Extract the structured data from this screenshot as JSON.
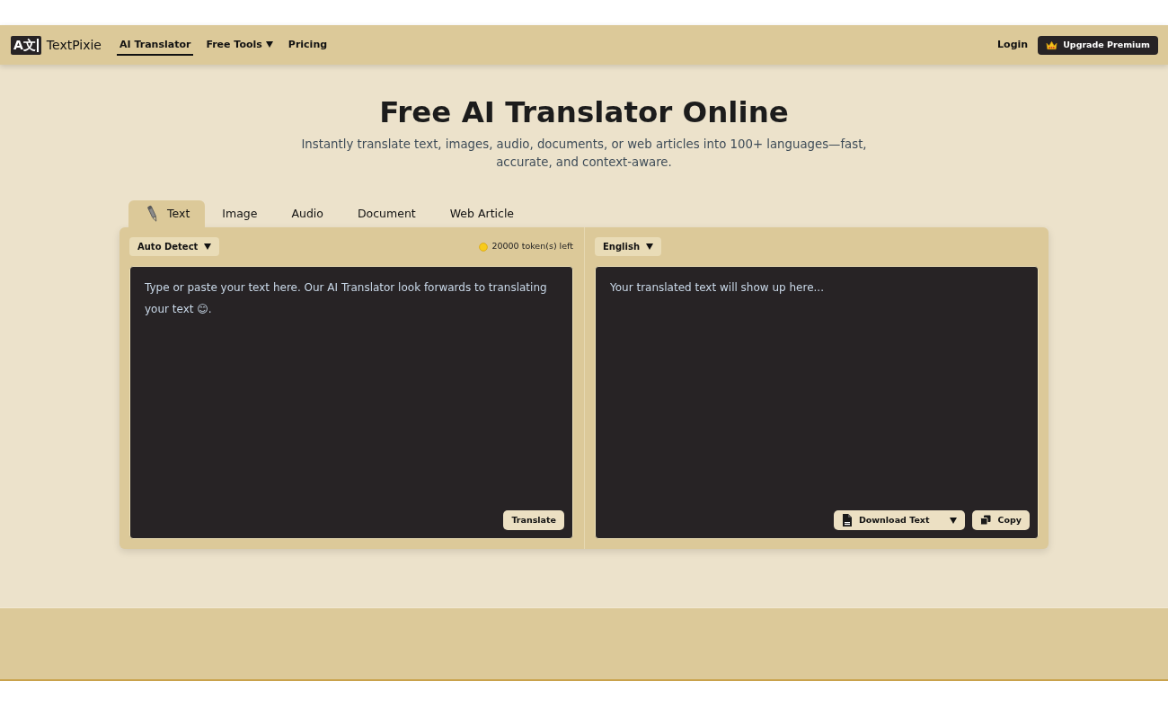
{
  "brand": {
    "logo_mark": "A文",
    "name": "TextPixie"
  },
  "nav": {
    "links": [
      {
        "label": "AI Translator",
        "selected": true,
        "kind": "link"
      },
      {
        "label": "Free Tools",
        "selected": false,
        "kind": "dropdown"
      },
      {
        "label": "Pricing",
        "selected": false,
        "kind": "link"
      }
    ],
    "login": "Login",
    "upgrade": "Upgrade Premium"
  },
  "hero": {
    "title": "Free AI Translator Online",
    "subtitle": "Instantly translate text, images, audio, documents, or web articles into 100+ languages—fast, accurate, and context-aware."
  },
  "tabs": [
    {
      "label": "Text",
      "selected": true
    },
    {
      "label": "Image",
      "selected": false
    },
    {
      "label": "Audio",
      "selected": false
    },
    {
      "label": "Document",
      "selected": false
    },
    {
      "label": "Web Article",
      "selected": false
    }
  ],
  "source": {
    "language": "Auto Detect",
    "tokens": "20000 token(s) left",
    "placeholder": "Type or paste your text here. Our AI Translator look forwards to translating your text 😊.",
    "action": "Translate"
  },
  "target": {
    "language": "English",
    "placeholder": "Your translated text will show up here...",
    "download": "Download Text",
    "copy": "Copy"
  }
}
